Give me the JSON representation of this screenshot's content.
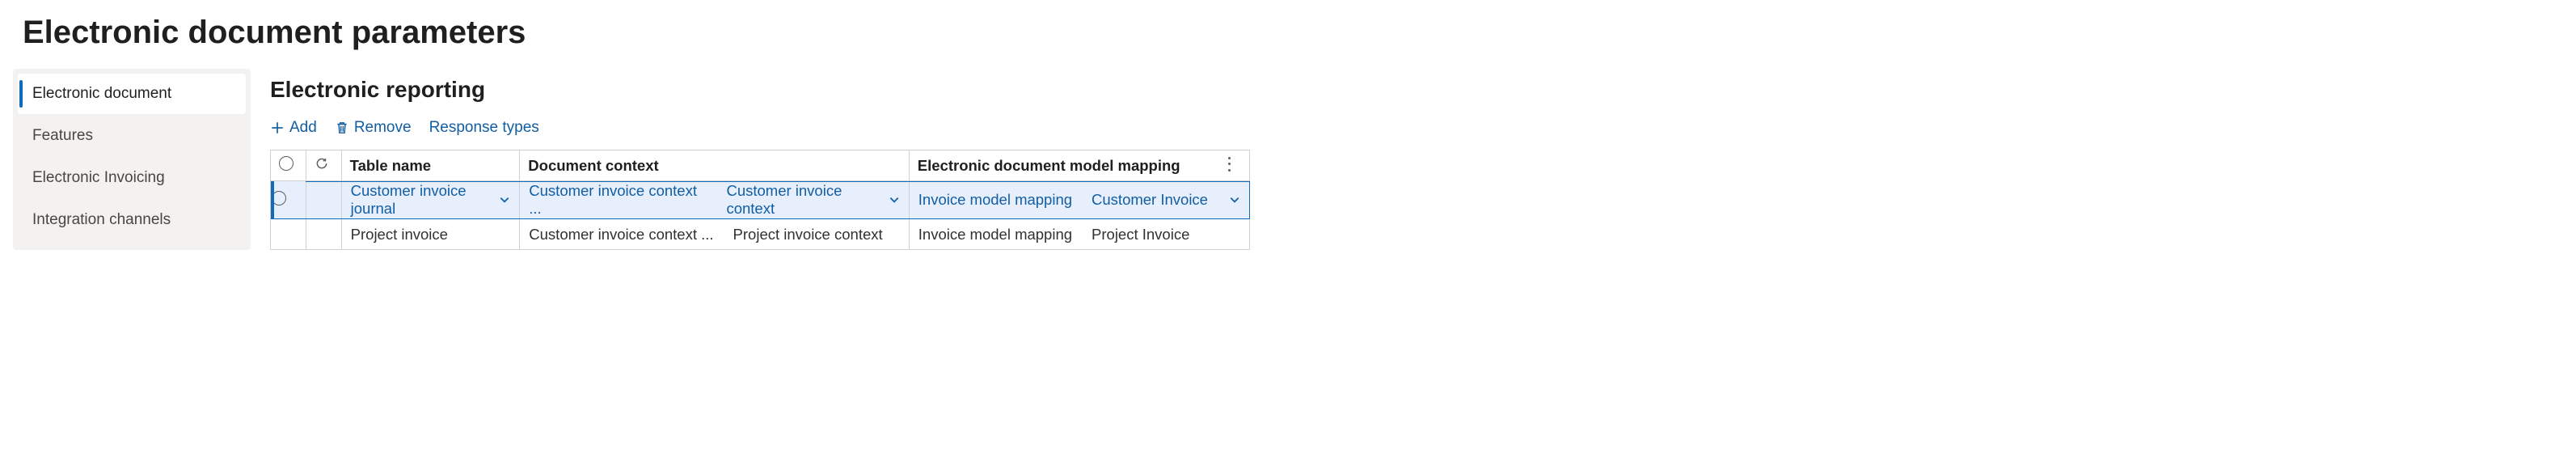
{
  "page_title": "Electronic document parameters",
  "sidebar": {
    "items": [
      {
        "label": "Electronic document",
        "active": true
      },
      {
        "label": "Features",
        "active": false
      },
      {
        "label": "Electronic Invoicing",
        "active": false
      },
      {
        "label": "Integration channels",
        "active": false
      }
    ]
  },
  "main": {
    "section_title": "Electronic reporting",
    "toolbar": {
      "add_label": "Add",
      "remove_label": "Remove",
      "response_types_label": "Response types"
    },
    "columns": {
      "table_name": "Table name",
      "document_context": "Document context",
      "model_mapping": "Electronic document model mapping"
    },
    "rows": [
      {
        "selected": true,
        "table_name": "Customer invoice journal",
        "doc_context_a": "Customer invoice context ...",
        "doc_context_b": "Customer invoice context",
        "model_mapping_a": "Invoice model mapping",
        "model_mapping_b": "Customer Invoice"
      },
      {
        "selected": false,
        "table_name": "Project invoice",
        "doc_context_a": "Customer invoice context ...",
        "doc_context_b": "Project invoice context",
        "model_mapping_a": "Invoice model mapping",
        "model_mapping_b": "Project Invoice"
      }
    ]
  }
}
